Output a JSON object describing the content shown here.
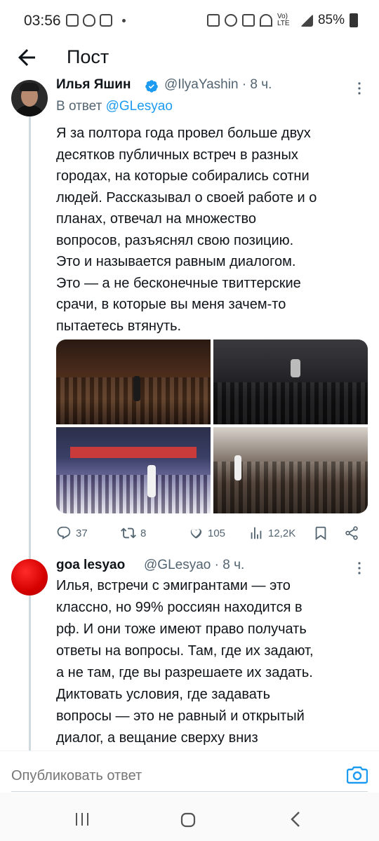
{
  "status_bar": {
    "time": "03:56",
    "battery": "85%",
    "network": "Vo) LTE"
  },
  "header": {
    "title": "Пост"
  },
  "tweet1": {
    "author_name": "Илья Яшин",
    "handle": "@IlyaYashin",
    "time": "· 8 ч.",
    "reply_prefix": "В ответ",
    "reply_to": "@GLesyao",
    "text": "Я за полтора года провел больше двух\nдесятков публичных встреч в разных\nгородах, на которые собирались сотни\nлюдей. Рассказывал о своей работе и о\nпланах, отвечал на множество\nвопросов, разъяснял свою позицию.\nЭто и называется равным диалогом.\nЭто — а не бесконечные твиттерские\nсрачи, в которые вы меня зачем-то\nпытаетесь втянуть.",
    "stats": {
      "replies": "37",
      "retweets": "8",
      "likes": "105",
      "views": "12,2K"
    }
  },
  "tweet2": {
    "author_name": "goa lesyao",
    "handle": "@GLesyao",
    "time": "· 8 ч.",
    "text": "Илья, встречи с эмигрантами — это\nклассно, но 99% россиян находится в\nрф. И они тоже имеют право получать\nответы на вопросы. Там, где их задают,\nа не там, где вы разрешаете их задать.\nДиктовать условия, где задавать\nвопросы — это не равный и открытый\nдиалог, а вещание сверху вниз"
  },
  "composer": {
    "placeholder": "Опубликовать ответ"
  },
  "colors": {
    "accent": "#1d9bf0",
    "secondary_text": "#536471",
    "primary_text": "#0f1419"
  }
}
